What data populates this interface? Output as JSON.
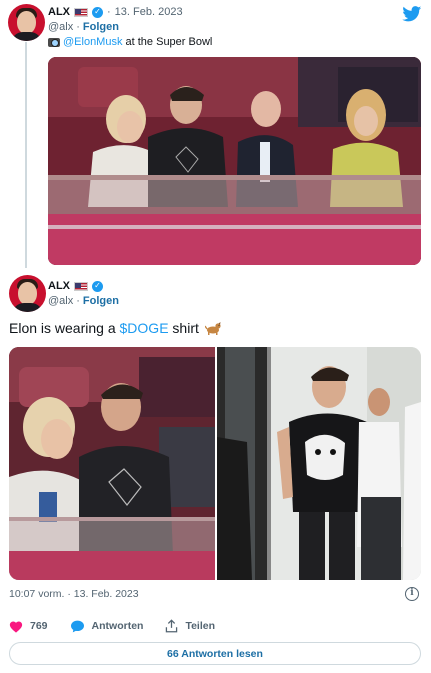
{
  "icons": {
    "twitter": "twitter-bird-icon",
    "verified": "verified-badge-icon",
    "flag": "us-flag-icon"
  },
  "colors": {
    "link": "#1d9bf0",
    "like": "#f91880",
    "muted": "#536471"
  },
  "quoted_tweet": {
    "author_name": "ALX",
    "handle": "@alx",
    "separator": "·",
    "date": "13. Feb. 2023",
    "follow_label": "Folgen",
    "caption_mention": "@ElonMusk",
    "caption_rest": " at the Super Bowl"
  },
  "main_tweet": {
    "author_name": "ALX",
    "handle": "@alx",
    "separator": "·",
    "follow_label": "Folgen",
    "text_before": "Elon is wearing a ",
    "cashtag": "$DOGE",
    "text_after": " shirt",
    "timestamp": "10:07 vorm. · 13. Feb. 2023",
    "like_count": "769",
    "reply_label": "Antworten",
    "share_label": "Teilen",
    "read_replies_label": "66 Antworten lesen"
  }
}
